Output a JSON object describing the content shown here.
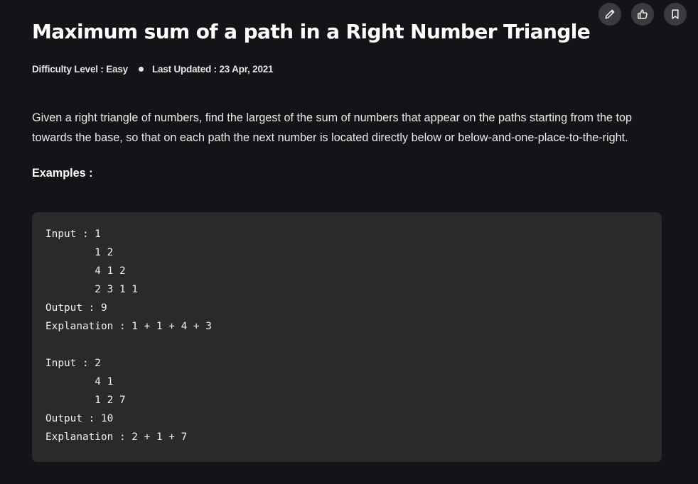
{
  "title": "Maximum sum of a path in a Right Number Triangle",
  "meta": {
    "difficulty": "Difficulty Level : Easy",
    "updated": "Last Updated : 23 Apr, 2021"
  },
  "description": "Given a right triangle of numbers, find the largest of the sum of numbers that appear on the paths starting from the top towards the base, so that on each path the next number is located directly below or below-and-one-place-to-the-right.",
  "examples_label": "Examples :",
  "code": "Input : 1\n        1 2\n        4 1 2\n        2 3 1 1\nOutput : 9\nExplanation : 1 + 1 + 4 + 3\n\nInput : 2\n        4 1\n        1 2 7\nOutput : 10\nExplanation : 2 + 1 + 7",
  "actions": [
    "pencil-icon",
    "thumbs-up-icon",
    "bookmark-icon"
  ]
}
